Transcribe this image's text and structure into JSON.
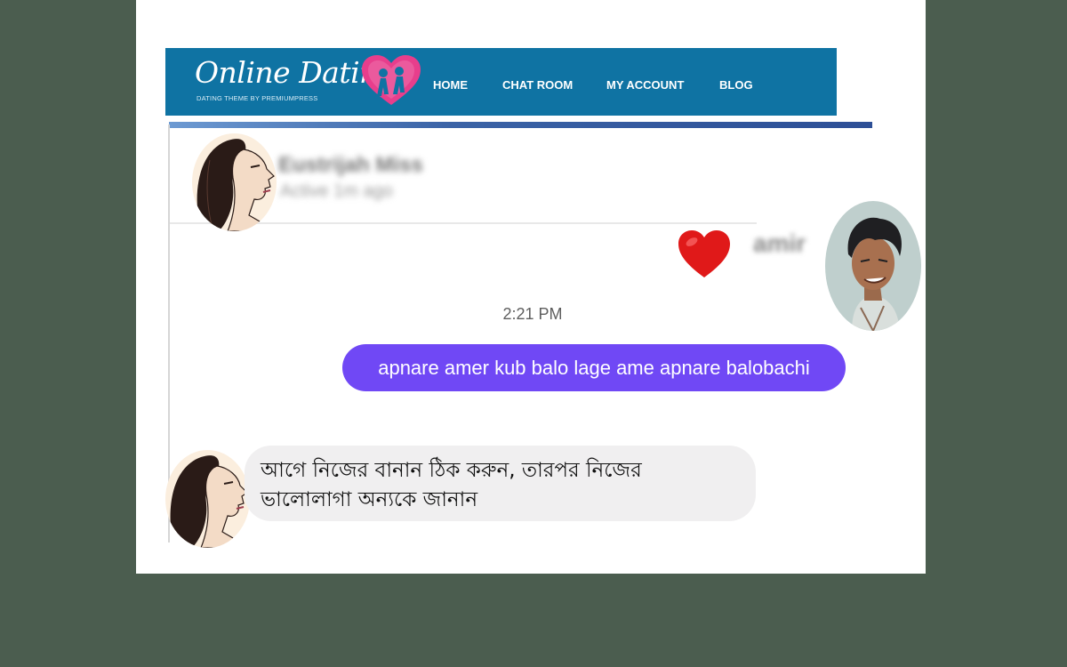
{
  "site": {
    "logo_text": "Online Dating",
    "logo_tagline": "DATING THEME BY PREMIUMPRESS",
    "brand_color": "#0f73a3",
    "accent_color": "#e83e8c"
  },
  "nav": {
    "items": [
      {
        "label": "HOME"
      },
      {
        "label": "CHAT ROOM"
      },
      {
        "label": "MY ACCOUNT"
      },
      {
        "label": "BLOG"
      }
    ]
  },
  "profile": {
    "name": "Eustrijah Miss",
    "status": "Active 1m ago",
    "avatar_icon": "woman-profile-avatar"
  },
  "reaction": {
    "icon": "red-heart-icon",
    "user_name": "amir",
    "avatar_icon": "man-cartoon-avatar"
  },
  "chat": {
    "timestamp": "2:21 PM",
    "outgoing_message": "apnare amer kub balo lage ame apnare balobachi",
    "outgoing_color": "#7048f5",
    "incoming_message": "আগে নিজের বানান ঠিক করুন, তারপর নিজের ভালোলাগা অন্যকে জানান",
    "incoming_color": "#f0eff0"
  }
}
